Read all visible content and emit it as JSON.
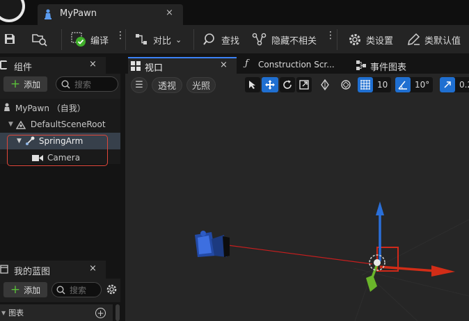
{
  "app": {
    "asset_tab_title": "MyPawn",
    "close_glyph": "×"
  },
  "toolbar": {
    "compile_label": "编译",
    "diff_label": "对比",
    "find_label": "查找",
    "hide_unrelated_label": "隐藏不相关",
    "class_settings_label": "类设置",
    "class_defaults_label": "类默认值"
  },
  "components_panel": {
    "title": "组件",
    "add_label": "添加",
    "search_placeholder": "搜索",
    "tree": [
      {
        "label": "MyPawn （自我）"
      },
      {
        "label": "DefaultSceneRoot"
      },
      {
        "label": "SpringArm"
      },
      {
        "label": "Camera"
      }
    ]
  },
  "my_blueprint_panel": {
    "title": "我的蓝图",
    "add_label": "添加",
    "search_placeholder": "搜索",
    "section_graphs": "图表"
  },
  "editor_tabs": {
    "viewport": "视口",
    "construction_script": "Construction Scr...",
    "event_graph": "事件图表"
  },
  "viewport_toolbar": {
    "perspective_label": "透视",
    "lit_label": "光照",
    "grid_snap_value": "10",
    "rotation_snap_value": "10°",
    "scale_snap_value": "0.2"
  },
  "colors": {
    "accent_blue": "#1f6fd1",
    "highlight_row": "#37404b",
    "selection_outline": "#e0473a",
    "axis_x": "#d22d17",
    "axis_y": "#6ab52a",
    "axis_z": "#2a6fd8"
  }
}
